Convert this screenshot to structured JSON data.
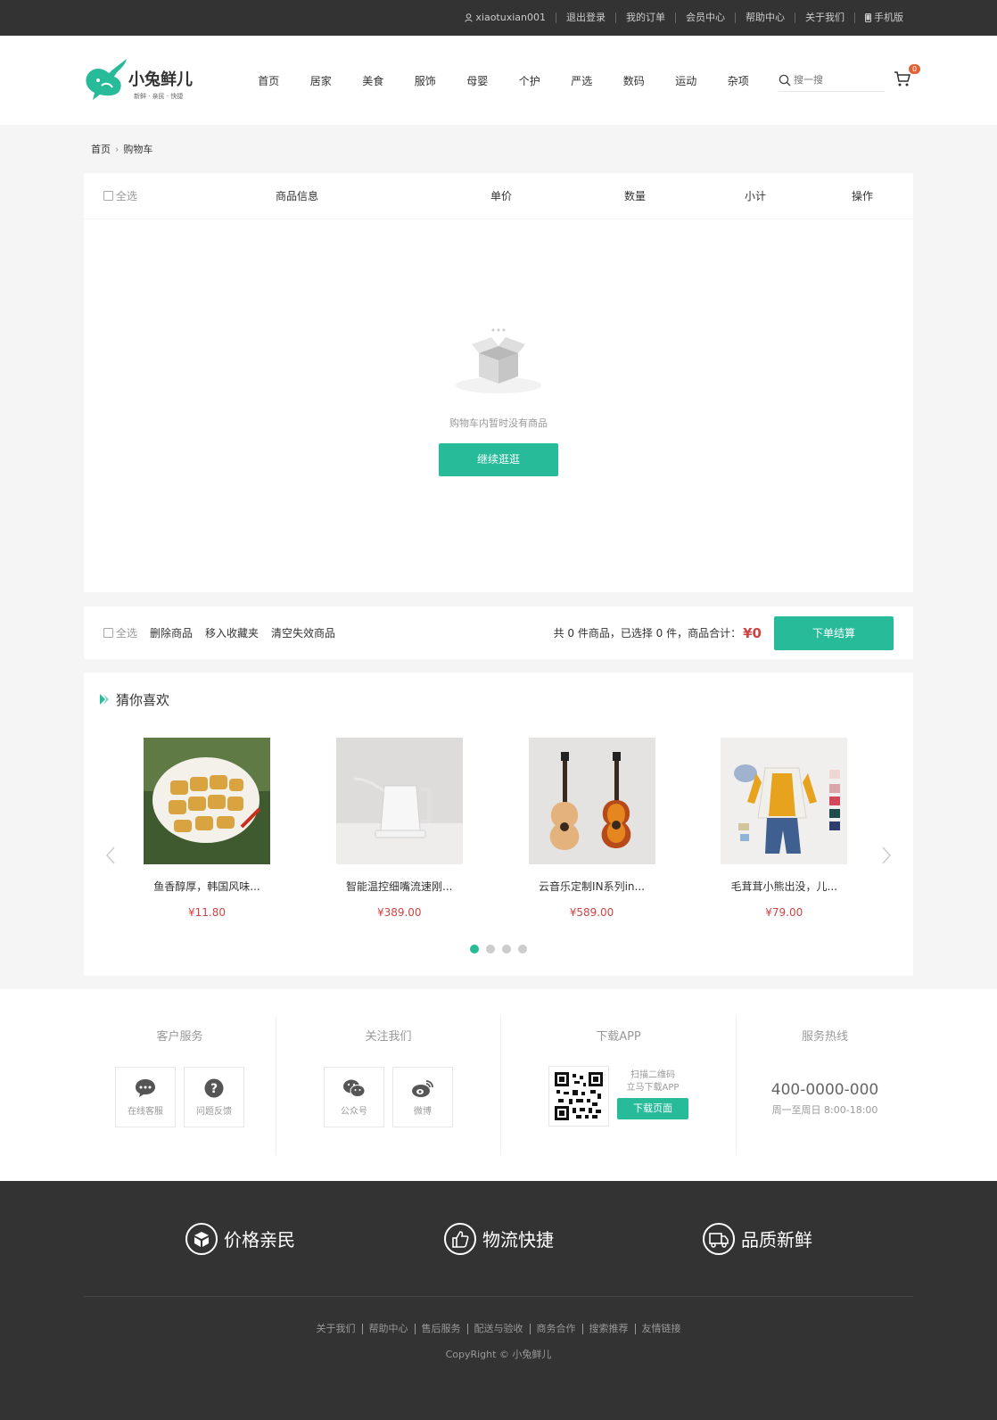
{
  "topbar": {
    "username": "xiaotuxian001",
    "links": [
      "退出登录",
      "我的订单",
      "会员中心",
      "帮助中心",
      "关于我们"
    ],
    "mobile": "手机版"
  },
  "header": {
    "brand_name": "小兔鲜儿",
    "brand_slogan": "新鲜 · 亲民 · 快捷",
    "nav": [
      "首页",
      "居家",
      "美食",
      "服饰",
      "母婴",
      "个护",
      "严选",
      "数码",
      "运动",
      "杂项"
    ],
    "search_placeholder": "搜一搜",
    "cart_count": "0",
    "accent": "#27bb9a"
  },
  "breadcrumb": {
    "home": "首页",
    "current": "购物车"
  },
  "cart": {
    "columns": {
      "select_all": "全选",
      "info": "商品信息",
      "price": "单价",
      "qty": "数量",
      "subtotal": "小计",
      "action": "操作"
    },
    "empty_text": "购物车内暂时没有商品",
    "continue_button": "继续逛逛"
  },
  "actionbar": {
    "select_all": "全选",
    "delete": "删除商品",
    "move_fav": "移入收藏夹",
    "clear_invalid": "清空失效商品",
    "summary": "共 0 件商品，已选择 0 件，商品合计：",
    "total": "¥0",
    "checkout": "下单结算"
  },
  "recommend": {
    "title": "猜你喜欢",
    "items": [
      {
        "name": "鱼香醇厚，韩国风味...",
        "price": "¥11.80",
        "image": "skewers-photo"
      },
      {
        "name": "智能温控细嘴流速刚...",
        "price": "¥389.00",
        "image": "kettle-photo"
      },
      {
        "name": "云音乐定制IN系列in...",
        "price": "¥589.00",
        "image": "guitar-photo"
      },
      {
        "name": "毛茸茸小熊出没，儿...",
        "price": "¥79.00",
        "image": "kids-clothes-photo"
      }
    ],
    "dots": 4,
    "active_dot": 0
  },
  "service": {
    "customer": {
      "title": "客户服务",
      "items": [
        "在线客服",
        "问题反馈"
      ]
    },
    "follow": {
      "title": "关注我们",
      "items": [
        "公众号",
        "微博"
      ]
    },
    "app": {
      "title": "下载APP",
      "line1": "扫描二维码",
      "line2": "立马下载APP",
      "button": "下载页面"
    },
    "hotline": {
      "title": "服务热线",
      "phone": "400-0000-000",
      "hours": "周一至周日 8:00-18:00"
    }
  },
  "bottom": {
    "promises": [
      "价格亲民",
      "物流快捷",
      "品质新鲜"
    ],
    "links": [
      "关于我们",
      "帮助中心",
      "售后服务",
      "配送与验收",
      "商务合作",
      "搜索推荐",
      "友情链接"
    ],
    "copyright": "CopyRight © 小兔鲜儿"
  }
}
